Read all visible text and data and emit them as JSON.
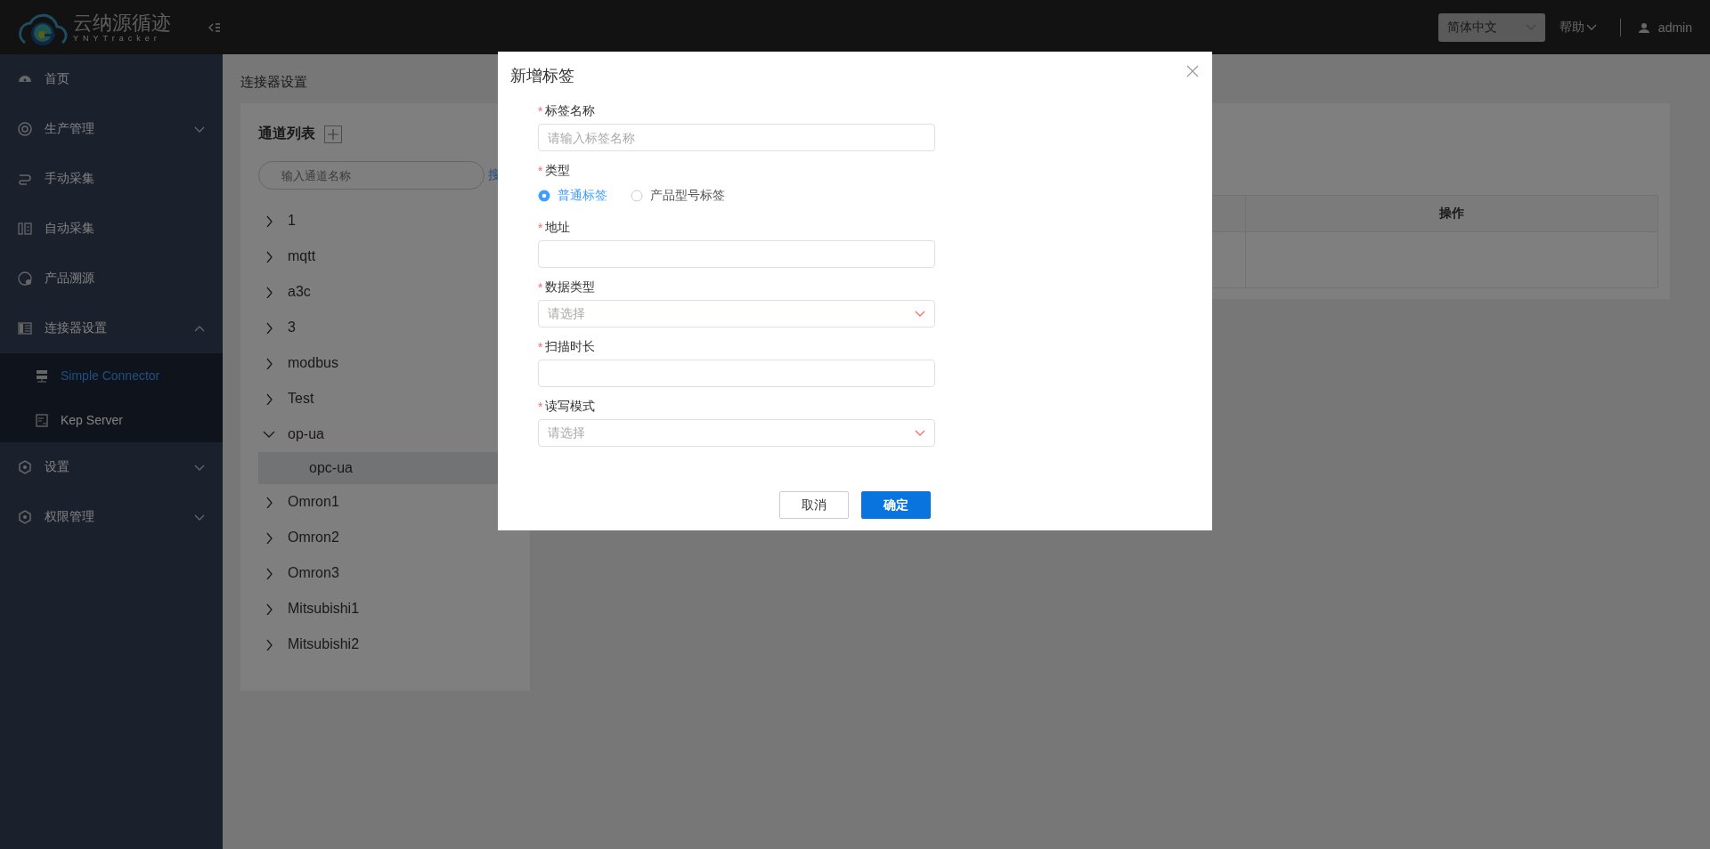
{
  "header": {
    "logo_title": "云纳源循迹",
    "logo_subtitle": "YNYTracker",
    "language": "简体中文",
    "help": "帮助",
    "user": "admin"
  },
  "sidebar": {
    "items": [
      {
        "kind": "link",
        "label": "首页"
      },
      {
        "kind": "group",
        "label": "生产管理",
        "expanded": false
      },
      {
        "kind": "link",
        "label": "手动采集"
      },
      {
        "kind": "link",
        "label": "自动采集"
      },
      {
        "kind": "link",
        "label": "产品溯源"
      },
      {
        "kind": "group",
        "label": "连接器设置",
        "expanded": true,
        "children": [
          {
            "label": "Simple Connector",
            "selected": true
          },
          {
            "label": "Kep Server",
            "selected": false
          }
        ]
      },
      {
        "kind": "group",
        "label": "设置",
        "expanded": false
      },
      {
        "kind": "group",
        "label": "权限管理",
        "expanded": false
      }
    ]
  },
  "breadcrumb": "连接器设置",
  "channel_panel": {
    "title": "通道列表",
    "search": {
      "placeholder": "输入通道名称"
    },
    "search_button": "搜",
    "tree": [
      {
        "label": "1",
        "expanded": false
      },
      {
        "label": "mqtt",
        "expanded": false
      },
      {
        "label": "a3c",
        "expanded": false
      },
      {
        "label": "3",
        "expanded": false
      },
      {
        "label": "modbus",
        "expanded": false
      },
      {
        "label": "Test",
        "expanded": false
      },
      {
        "label": "op-ua",
        "expanded": true,
        "children": [
          {
            "label": "opc-ua",
            "selected": true
          }
        ]
      },
      {
        "label": "Omron1",
        "expanded": false
      },
      {
        "label": "Omron2",
        "expanded": false
      },
      {
        "label": "Omron3",
        "expanded": false
      },
      {
        "label": "Mitsubishi1",
        "expanded": false
      },
      {
        "label": "Mitsubishi2",
        "expanded": false
      }
    ]
  },
  "table": {
    "columns": [
      {
        "label": "操作"
      }
    ]
  },
  "dialog": {
    "title": "新增标签",
    "fields": [
      {
        "kind": "text",
        "mark": "*",
        "label": "标签名称",
        "placeholder": "请输入标签名称"
      },
      {
        "kind": "radio",
        "mark": "*",
        "label": "类型",
        "options": [
          {
            "label": "普通标签",
            "selected": true
          },
          {
            "label": "产品型号标签",
            "selected": false
          }
        ]
      },
      {
        "kind": "text",
        "mark": "*",
        "label": "地址"
      },
      {
        "kind": "select",
        "mark": "*",
        "label": "数据类型",
        "placeholder": "请选择"
      },
      {
        "kind": "text",
        "mark": "*",
        "label": "扫描时长"
      },
      {
        "kind": "select",
        "mark": "*",
        "label": "读写模式",
        "placeholder": "请选择"
      }
    ],
    "buttons": [
      {
        "kind": "default",
        "label": "取消"
      },
      {
        "kind": "primary",
        "label": "确定"
      }
    ]
  }
}
